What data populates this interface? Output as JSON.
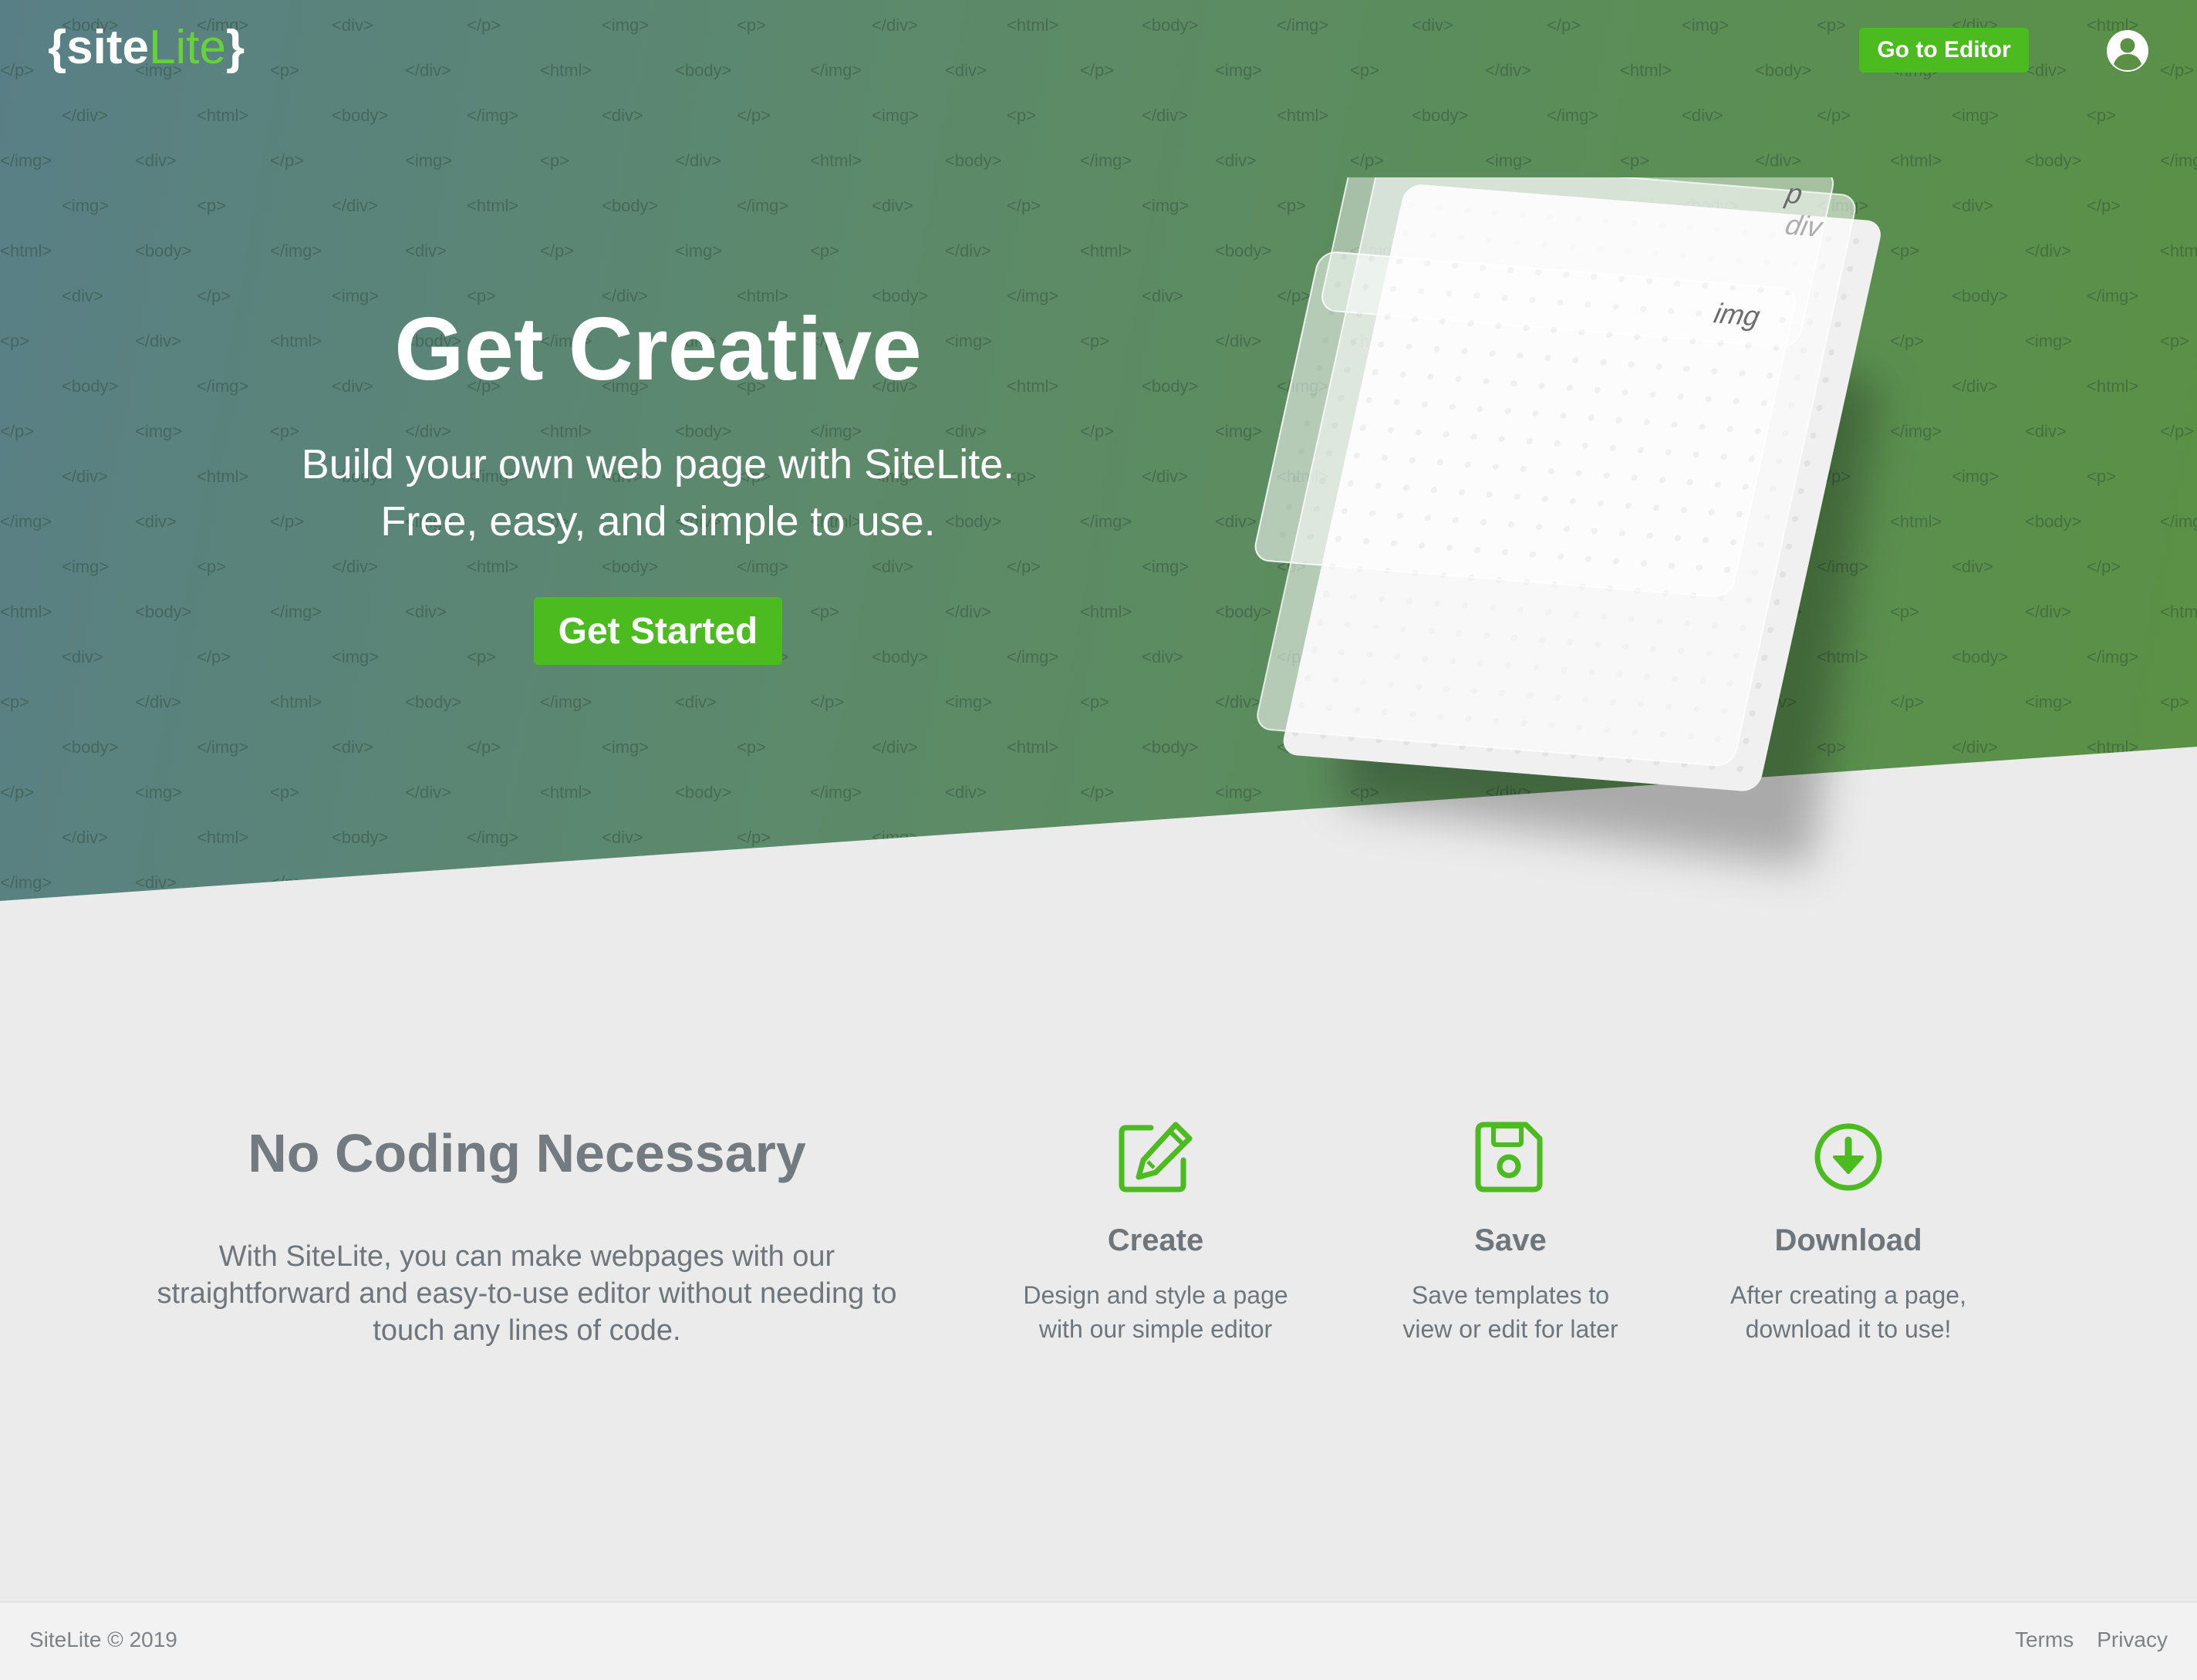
{
  "colors": {
    "accent": "#4cbb1f",
    "hero_start": "#597f86",
    "hero_end": "#5a9144",
    "text_gray": "#747b80",
    "background": "#ebebeb"
  },
  "header": {
    "logo": {
      "open_brace": "{",
      "site": "site",
      "lite": "Lite",
      "close_brace": "}"
    },
    "editor_button": "Go to Editor",
    "account_icon": "user-circle-icon"
  },
  "hero": {
    "title": "Get Creative",
    "subtitle_line1": "Build your own web page with SiteLite.",
    "subtitle_line2": "Free, easy, and simple to use.",
    "cta": "Get Started",
    "background_tags": [
      "<img>",
      "<p>",
      "</div>",
      "<html>",
      "<body>",
      "</img>",
      "<div>",
      "</p>"
    ],
    "illustration_labels": {
      "p": "p",
      "div": "div",
      "img": "img"
    }
  },
  "intro": {
    "title": "No Coding Necessary",
    "text": "With SiteLite, you can make webpages with our straightforward and easy-to-use editor without needing to touch any lines of code."
  },
  "features": [
    {
      "icon": "edit-icon",
      "title": "Create",
      "line1": "Design and style a page",
      "line2": "with our simple editor"
    },
    {
      "icon": "save-icon",
      "title": "Save",
      "line1": "Save templates to",
      "line2": "view or edit for later"
    },
    {
      "icon": "download-icon",
      "title": "Download",
      "line1": "After creating a page,",
      "line2": "download it to use!"
    }
  ],
  "footer": {
    "copyright": "SiteLite © 2019",
    "terms": "Terms",
    "privacy": "Privacy"
  }
}
